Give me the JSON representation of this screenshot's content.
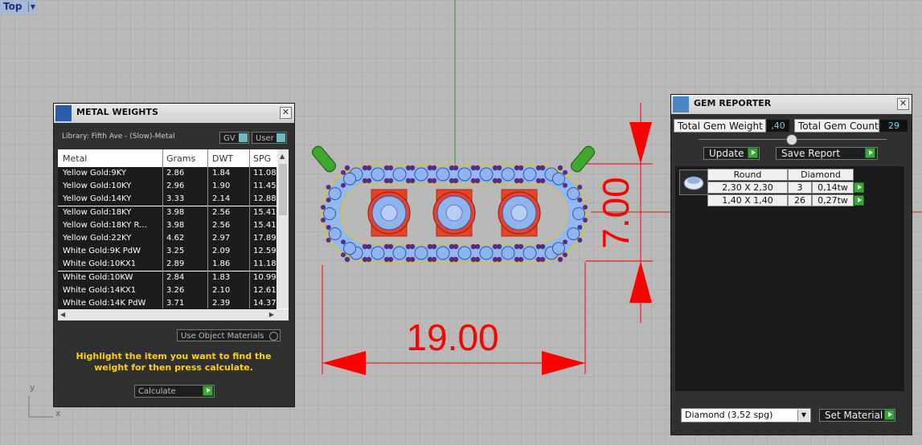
{
  "viewport": {
    "label": "Top",
    "axis_y": "y",
    "axis_x": "x",
    "dim_width": "19.00",
    "dim_height": "7.00"
  },
  "metal_weights": {
    "title": "METAL WEIGHTS",
    "library": "Library: Fifth Ave - (Slow)-Metal",
    "gv_label": "GV",
    "user_label": "User",
    "columns": [
      "Metal",
      "Grams",
      "DWT",
      "SPG"
    ],
    "rows": [
      [
        "Yellow Gold:9KY",
        "2.86",
        "1.84",
        "11.08"
      ],
      [
        "Yellow Gold:10KY",
        "2.96",
        "1.90",
        "11.45"
      ],
      [
        "Yellow Gold:14KY",
        "3.33",
        "2.14",
        "12.88"
      ],
      [
        "Yellow Gold:18KY",
        "3.98",
        "2.56",
        "15.41"
      ],
      [
        "Yellow Gold:18KY R...",
        "3.98",
        "2.56",
        "15.41"
      ],
      [
        "Yellow Gold:22KY",
        "4.62",
        "2.97",
        "17.89"
      ],
      [
        "White Gold:9K PdW",
        "3.25",
        "2.09",
        "12.59"
      ],
      [
        "White Gold:10KX1",
        "2.89",
        "1.86",
        "11.18"
      ],
      [
        "White Gold:10KW",
        "2.84",
        "1.83",
        "10.99"
      ],
      [
        "White Gold:14KX1",
        "3.26",
        "2.10",
        "12.61"
      ],
      [
        "White Gold:14K PdW",
        "3.71",
        "2.39",
        "14.37"
      ]
    ],
    "use_object_materials": "Use Object Materials",
    "hint": "Highlight the item you want to find the weight for then press calculate.",
    "calculate": "Calculate"
  },
  "gem_reporter": {
    "title": "GEM REPORTER",
    "total_weight_label": "Total Gem Weight",
    "total_weight_value": ",40",
    "total_count_label": "Total Gem Count",
    "total_count_value": "29",
    "update": "Update",
    "save_report": "Save Report",
    "shape": "Round",
    "material": "Diamond",
    "gems": [
      {
        "size": "2,30 X 2,30",
        "count": "3",
        "weight": "0,14tw"
      },
      {
        "size": "1,40 X 1,40",
        "count": "26",
        "weight": "0,27tw"
      }
    ],
    "material_select": "Diamond     (3,52 spg)",
    "set_material": "Set Material"
  },
  "colors": {
    "viewport_bg": "#b9b9b9",
    "dimension_red": "#ff0000",
    "panel_bg": "#303030",
    "gem_blue": "#8fb4ee",
    "setting_red": "#e8432a",
    "prong_purple": "#5a2b86",
    "hint_yellow": "#ffd200"
  }
}
